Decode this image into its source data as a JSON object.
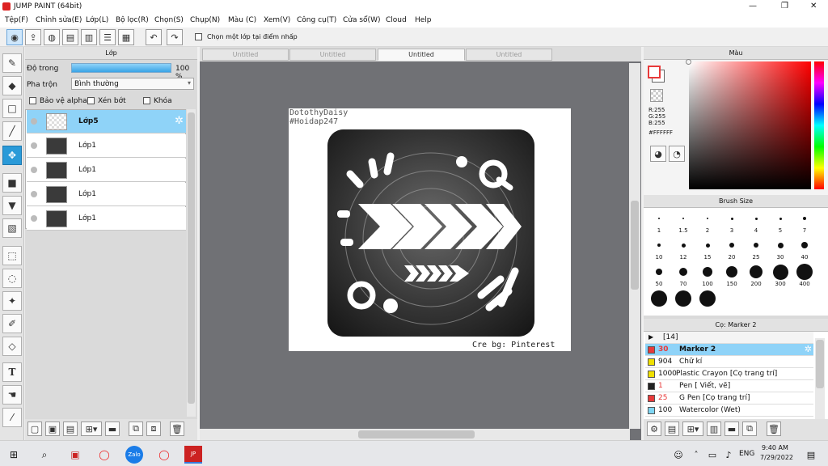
{
  "window": {
    "title": "JUMP PAINT (64bit)",
    "controls": [
      "—",
      "❐",
      "✕"
    ]
  },
  "menu": [
    "Tệp(F)",
    "Chỉnh sửa(E)",
    "Lớp(L)",
    "Bộ lọc(R)",
    "Chọn(S)",
    "Chụp(N)",
    "Màu (C)",
    "Xem(V)",
    "Công cụ(T)",
    "Cửa sổ(W)",
    "Cloud",
    "Help"
  ],
  "toolbar": {
    "checkbox_label": "Chọn một lớp tại điểm nhấp"
  },
  "layer_panel": {
    "title": "Lớp",
    "opacity_label": "Độ trong",
    "opacity_value": "100 %",
    "opacity_fraction": 1.0,
    "blend_label": "Pha trộn",
    "blend_value": "Bình thường",
    "protect_alpha": "Bảo vệ alpha",
    "clipping": "Xén bớt",
    "lock": "Khóa",
    "layers": [
      {
        "name": "Lớp5",
        "selected": true
      },
      {
        "name": "Lớp1",
        "selected": false
      },
      {
        "name": "Lớp1",
        "selected": false
      },
      {
        "name": "Lớp1",
        "selected": false
      },
      {
        "name": "Lớp1",
        "selected": false
      }
    ]
  },
  "canvas": {
    "tabs": [
      "Untitled",
      "Untitled",
      "Untitled",
      "Untitled"
    ],
    "active_tab": 2,
    "text_top_1": "DotothyDaisy",
    "text_top_2": "#Hoidap247",
    "text_bottom": "Cre bg: Pinterest"
  },
  "color_panel": {
    "title": "Màu",
    "r": "R:255",
    "g": "G:255",
    "b": "B:255",
    "hex": "#FFFFFF",
    "foreground": "#ffffff",
    "background_swatch": "#e83a3a"
  },
  "brush_size": {
    "title": "Brush Size",
    "sizes": [
      "1",
      "1.5",
      "2",
      "3",
      "4",
      "5",
      "7",
      "10",
      "12",
      "15",
      "20",
      "25",
      "30",
      "40",
      "50",
      "70",
      "100",
      "150",
      "200",
      "300",
      "400",
      "",
      "",
      ""
    ]
  },
  "brush_panel": {
    "title": "Cọ: Marker 2",
    "group": "[14]",
    "items": [
      {
        "size": "30",
        "name": "Marker 2",
        "color": "#e83a3a",
        "selected": true
      },
      {
        "size": "904",
        "name": "Chữ kí",
        "color": "#f0e000",
        "selected": false
      },
      {
        "size": "1000",
        "name": "Plastic Crayon [Cọ trang trí]",
        "color": "#f0e000",
        "selected": false
      },
      {
        "size": "1",
        "name": "Pen [ Viết, vẽ]",
        "color": "#222222",
        "selected": false
      },
      {
        "size": "25",
        "name": "G Pen [Cọ trang trí]",
        "color": "#e83a3a",
        "selected": false
      },
      {
        "size": "100",
        "name": "Watercolor (Wet)",
        "color": "#7fd6f4",
        "selected": false
      }
    ]
  },
  "taskbar": {
    "time": "9:40 AM",
    "date": "7/29/2022",
    "lang": "ENG"
  }
}
